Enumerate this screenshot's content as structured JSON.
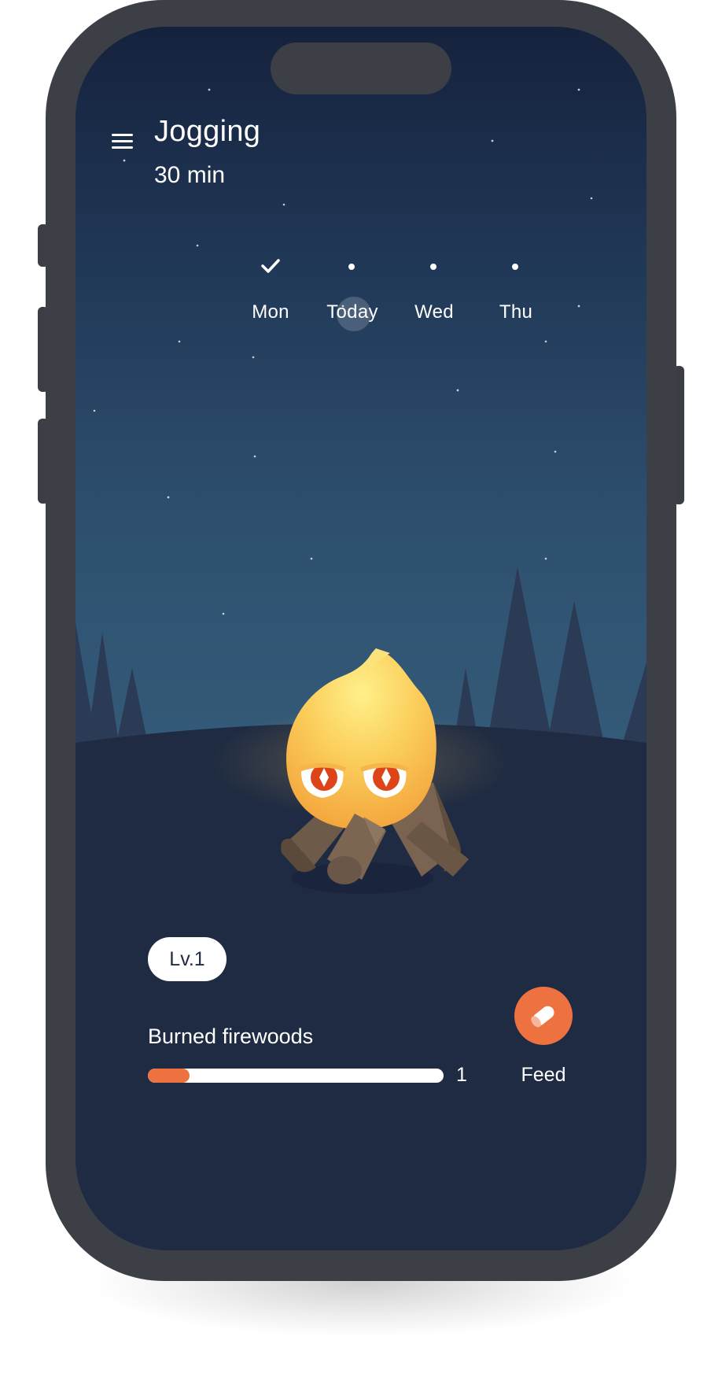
{
  "habit": {
    "title": "Jogging",
    "duration": "30 min"
  },
  "week": [
    {
      "label": "Mon",
      "status": "completed",
      "icon": "check-icon"
    },
    {
      "label": "Today",
      "status": "current",
      "icon": "dot-icon"
    },
    {
      "label": "Wed",
      "status": "upcoming",
      "icon": "dot-icon"
    },
    {
      "label": "Thu",
      "status": "upcoming",
      "icon": "dot-icon"
    }
  ],
  "campfire": {
    "level": "Lv.1",
    "progress_label": "Burned firewoods",
    "count": "1",
    "progress_fraction": 0.14
  },
  "actions": {
    "feed_label": "Feed",
    "feed_icon": "firewood-icon",
    "menu_icon": "menu-icon"
  },
  "colors": {
    "accent": "#ee7240",
    "ground": "#1f2b42",
    "sky_top": "#15223d",
    "sky_bottom": "#34597a"
  }
}
